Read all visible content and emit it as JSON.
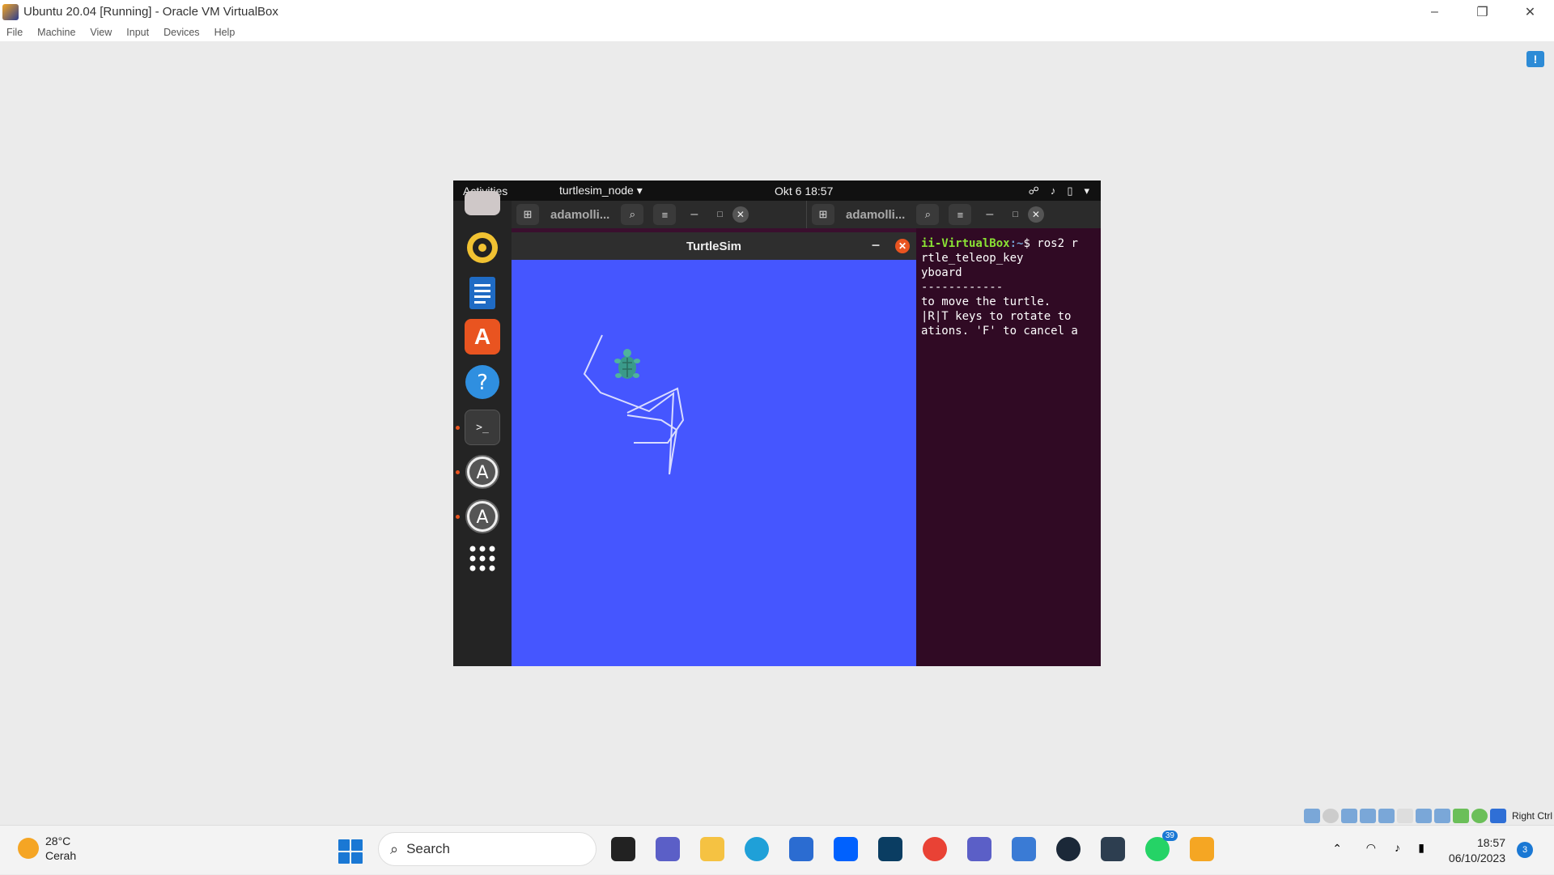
{
  "host": {
    "title": "Ubuntu 20.04 [Running] - Oracle VM VirtualBox",
    "menu": [
      "File",
      "Machine",
      "View",
      "Input",
      "Devices",
      "Help"
    ],
    "window_controls": [
      "–",
      "❐",
      "✕"
    ],
    "status_right_ctrl": "Right Ctrl"
  },
  "gnome": {
    "activities": "Activities",
    "app_menu": "turtlesim_node ▾",
    "clock": "Okt 6  18:57",
    "tray": [
      "☍",
      "♪",
      "▯",
      "▾"
    ]
  },
  "terminals": {
    "tab1_title": "adamolli...",
    "tab2_title": "adamolli...",
    "term2_lines": [
      {
        "green": "ii-VirtualBox",
        "blue": ":~",
        "text": "$ ros2 r"
      },
      {
        "text": "rtle_teleop_key"
      },
      {
        "text": "yboard"
      },
      {
        "text": "------------"
      },
      {
        "text": "to move the turtle."
      },
      {
        "text": "|R|T keys to rotate to"
      },
      {
        "text": "ations. 'F' to cancel a"
      }
    ]
  },
  "turtlesim": {
    "title": "TurtleSim",
    "path_color": "#d9dcff",
    "background": "#4556ff"
  },
  "taskbar": {
    "weather_temp": "28°C",
    "weather_desc": "Cerah",
    "search_placeholder": "Search",
    "whatsapp_badge": "39",
    "time": "18:57",
    "date": "06/10/2023",
    "notification_count": "3"
  }
}
